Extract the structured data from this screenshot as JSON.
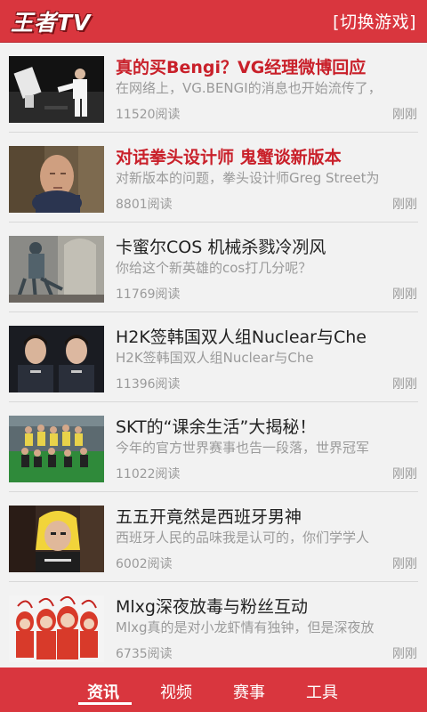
{
  "header": {
    "logo": "王者TV",
    "switch_game": "[切换游戏]"
  },
  "articles": [
    {
      "title": "真的买Bengi？VG经理微博回应",
      "summary": "在网络上，VG.BENGI的消息也开始流传了，",
      "reads": "11520阅读",
      "time": "刚刚",
      "highlight": true
    },
    {
      "title": "对话拳头设计师 鬼蟹谈新版本",
      "summary": "对新版本的问题，拳头设计师Greg Street为",
      "reads": "8801阅读",
      "time": "刚刚",
      "highlight": true
    },
    {
      "title": "卡蜜尔COS 机械杀戮冷冽风",
      "summary": "你给这个新英雄的cos打几分呢？",
      "reads": "11769阅读",
      "time": "刚刚",
      "highlight": false
    },
    {
      "title": "H2K签韩国双人组Nuclear与Che",
      "summary": "H2K签韩国双人组Nuclear与Che",
      "reads": "11396阅读",
      "time": "刚刚",
      "highlight": false
    },
    {
      "title": "SKT的“课余生活”大揭秘！",
      "summary": "今年的官方世界赛事也告一段落，世界冠军",
      "reads": "11022阅读",
      "time": "刚刚",
      "highlight": false
    },
    {
      "title": "五五开竟然是西班牙男神",
      "summary": "西班牙人民的品味我是认可的，你们学学人",
      "reads": "6002阅读",
      "time": "刚刚",
      "highlight": false
    },
    {
      "title": "Mlxg深夜放毒与粉丝互动",
      "summary": "Mlxg真的是对小龙虾情有独钟，但是深夜放",
      "reads": "6735阅读",
      "time": "刚刚",
      "highlight": false
    }
  ],
  "bottom_nav": [
    {
      "label": "资讯",
      "active": true
    },
    {
      "label": "视频",
      "active": false
    },
    {
      "label": "赛事",
      "active": false
    },
    {
      "label": "工具",
      "active": false
    }
  ],
  "colors": {
    "accent": "#d9363e",
    "highlight_title": "#c9202a",
    "muted_text": "#9a9a9a"
  }
}
